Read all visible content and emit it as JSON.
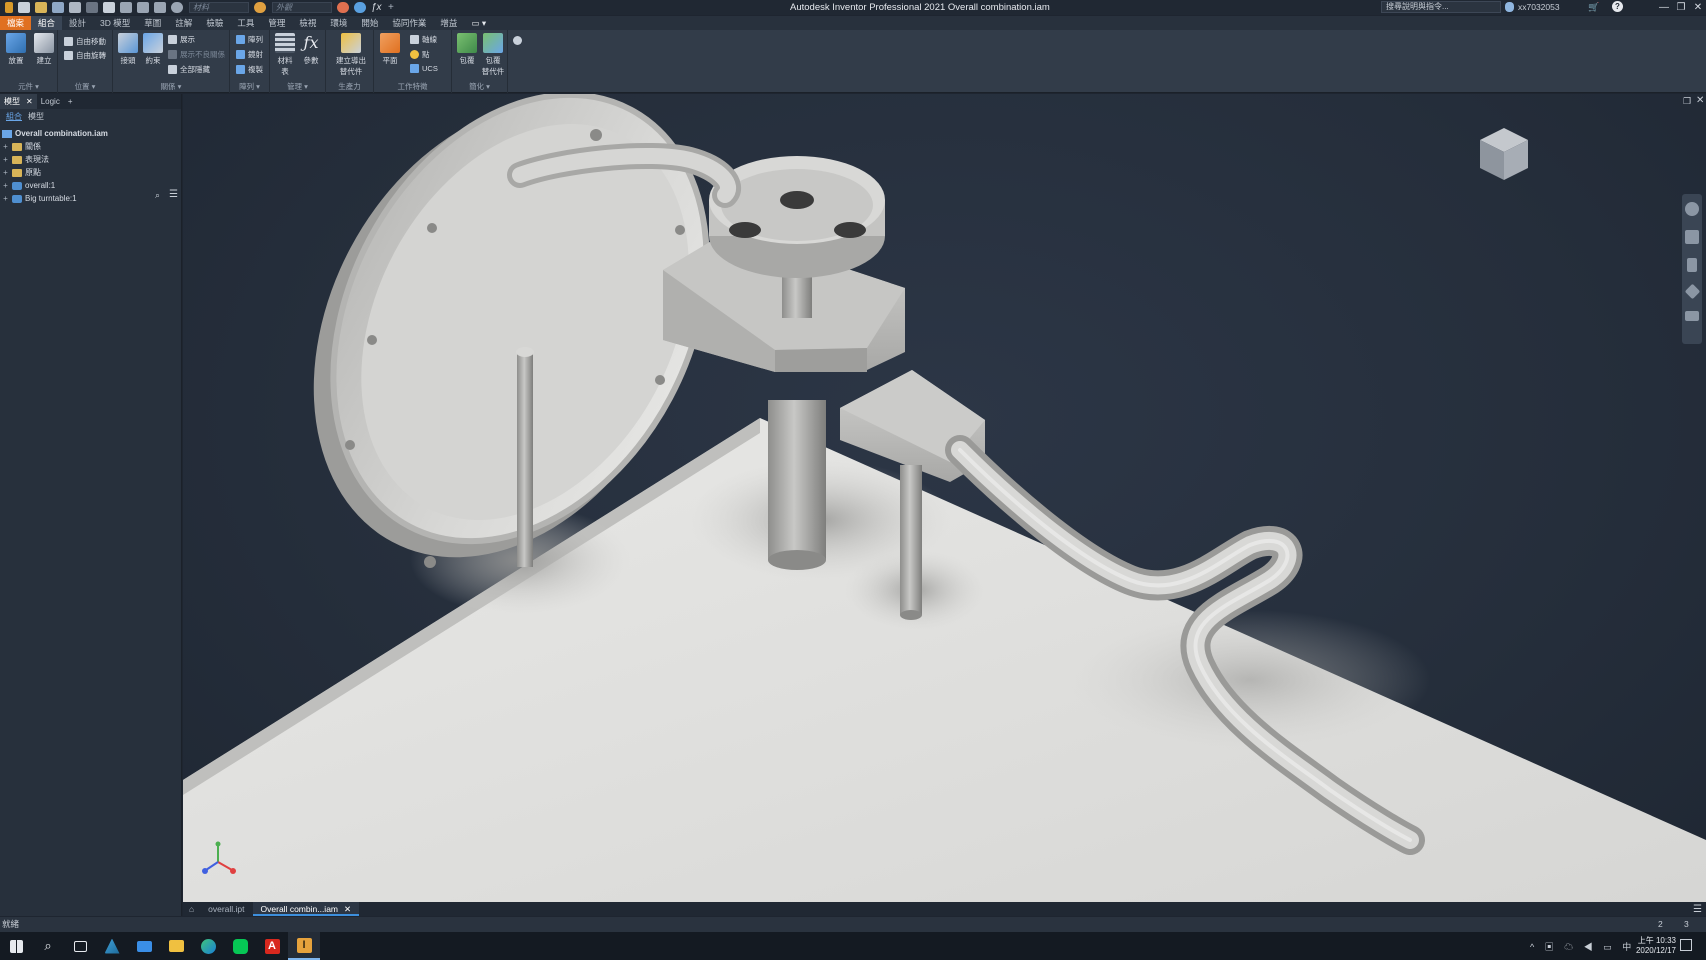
{
  "window": {
    "title": "Autodesk Inventor Professional 2021   Overall combination.iam",
    "help_search_placeholder": "搜尋說明與指令...",
    "user": "xx7032053",
    "controls": [
      "—",
      "❐",
      "✕"
    ]
  },
  "quick_access": {
    "material_box": "材料",
    "appearance_box": "外觀"
  },
  "ribbon_tabs": [
    "檔案",
    "組合",
    "設計",
    "3D 模型",
    "草圖",
    "註解",
    "檢驗",
    "工具",
    "管理",
    "檢視",
    "環境",
    "開始",
    "協同作業",
    "增益"
  ],
  "ribbon_active_tab": "組合",
  "ribbon_groups": [
    {
      "label": "元件 ▾",
      "buttons": [
        {
          "label": "放置"
        },
        {
          "label": "建立"
        }
      ]
    },
    {
      "label": "位置 ▾",
      "small": [
        "自由移動",
        "自由旋轉"
      ]
    },
    {
      "label": "關係 ▾",
      "buttons": [
        {
          "label": "接頭"
        },
        {
          "label": "約束"
        }
      ],
      "small": [
        "展示",
        "展示不良關係",
        "全部隱藏"
      ]
    },
    {
      "label": "陣列 ▾",
      "small": [
        "陣列",
        "鏡射",
        "複製"
      ]
    },
    {
      "label": "管理 ▾",
      "buttons": [
        {
          "label": "材料\n表"
        },
        {
          "label": "參數"
        }
      ]
    },
    {
      "label": "生產力",
      "buttons": [
        {
          "label": "建立導出\n替代件"
        }
      ]
    },
    {
      "label": "工作特徵",
      "buttons": [
        {
          "label": "平面"
        }
      ],
      "small": [
        "軸線",
        "點",
        "UCS"
      ]
    },
    {
      "label": "簡化 ▾",
      "buttons": [
        {
          "label": "包覆"
        },
        {
          "label": "包覆\n替代件"
        }
      ]
    }
  ],
  "browser": {
    "tabs": [
      "模型",
      "Logic"
    ],
    "sub_links": [
      "組合",
      "模型"
    ],
    "root": "Overall combination.iam",
    "items": [
      {
        "label": "關係",
        "type": "folder"
      },
      {
        "label": "表現法",
        "type": "folder"
      },
      {
        "label": "原點",
        "type": "folder"
      },
      {
        "label": "overall:1",
        "type": "part"
      },
      {
        "label": "Big turntable:1",
        "type": "part"
      }
    ]
  },
  "doc_tabs": [
    "overall.ipt",
    "Overall combin...iam"
  ],
  "doc_active": "Overall combin...iam",
  "status": {
    "text": "就緒",
    "num1": "2",
    "num2": "3"
  },
  "taskbar": {
    "time": "上午 10:33",
    "date": "2020/12/17",
    "ime": "中"
  }
}
